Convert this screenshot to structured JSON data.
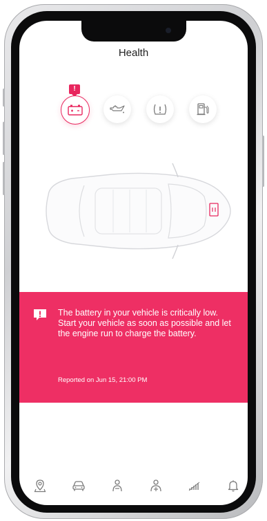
{
  "screen": {
    "title": "Health"
  },
  "status_icons": [
    {
      "icon": "battery-icon",
      "state": "alert"
    },
    {
      "icon": "oil-can-icon",
      "state": "normal"
    },
    {
      "icon": "tire-pressure-icon",
      "state": "normal"
    },
    {
      "icon": "fuel-pump-icon",
      "state": "normal"
    }
  ],
  "alert": {
    "message": "The battery in your vehicle is critically low. Start your vehicle as soon as possible and let the engine run to charge the battery.",
    "reported": "Reported on Jun 15, 21:00 PM",
    "badge": "!"
  },
  "tab_bar": [
    {
      "icon": "location-pin-icon"
    },
    {
      "icon": "car-icon"
    },
    {
      "icon": "driver-icon"
    },
    {
      "icon": "health-icon"
    },
    {
      "icon": "signal-bars-icon"
    },
    {
      "icon": "bell-icon"
    }
  ],
  "colors": {
    "accent": "#EE2F64",
    "icon_gray": "#7A7A7A",
    "text": "#1F1F1F"
  }
}
